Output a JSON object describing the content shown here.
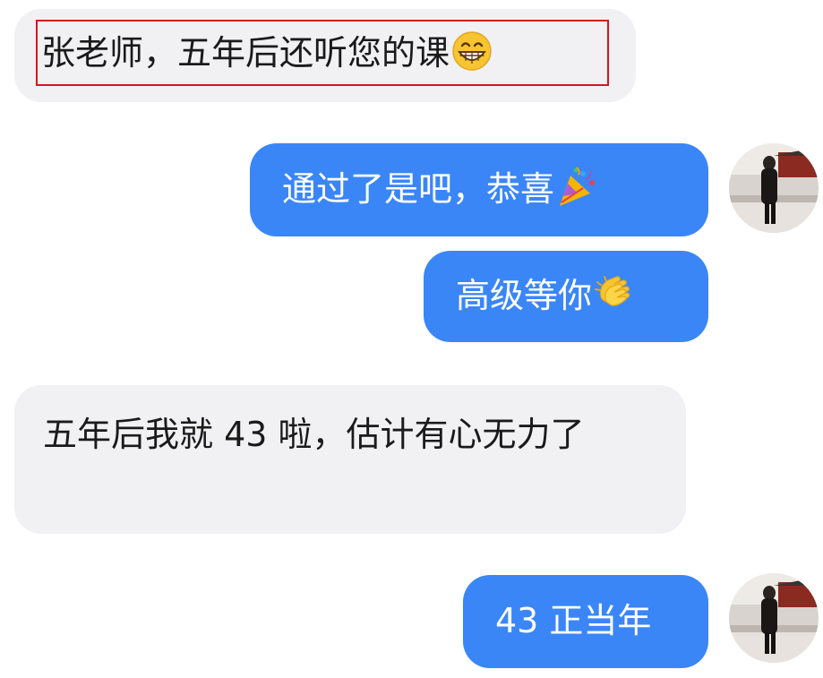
{
  "messages": [
    {
      "side": "incoming",
      "text": "张老师，五年后还听您的课",
      "emoji": "grinning-face-icon"
    },
    {
      "side": "outgoing",
      "text": "通过了是吧，恭喜",
      "emoji": "party-popper-icon"
    },
    {
      "side": "outgoing",
      "text": "高级等你",
      "emoji": "clapping-hands-icon"
    },
    {
      "side": "incoming",
      "text": "五年后我就 43 啦，估计有心无力了",
      "emoji": ""
    },
    {
      "side": "outgoing",
      "text": "43 正当年",
      "emoji": ""
    }
  ],
  "colors": {
    "incoming_bubble": "#f1f1f3",
    "outgoing_bubble": "#3a86f7",
    "outgoing_text": "#ffffff",
    "highlight_border": "#d8141f"
  }
}
